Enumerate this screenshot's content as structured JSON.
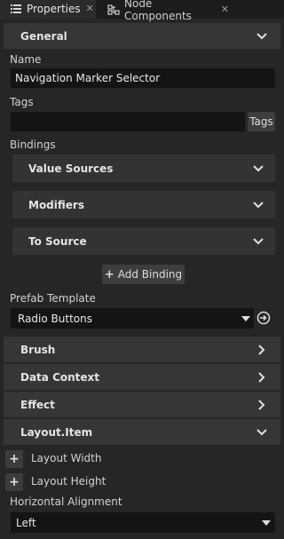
{
  "tabs": [
    {
      "label": "Properties",
      "icon": "list-icon",
      "active": true
    },
    {
      "label": "Node Components",
      "icon": "node-components-icon",
      "active": false
    }
  ],
  "sections": {
    "general": "General",
    "brush": "Brush",
    "data_context": "Data Context",
    "effect": "Effect",
    "layout_item": "Layout.Item"
  },
  "name": {
    "label": "Name",
    "value": "Navigation Marker Selector"
  },
  "tags": {
    "label": "Tags",
    "value": "",
    "button": "Tags"
  },
  "bindings": {
    "label": "Bindings",
    "groups": [
      "Value Sources",
      "Modifiers",
      "To Source"
    ],
    "add_button": "Add Binding"
  },
  "prefab_template": {
    "label": "Prefab Template",
    "value": "Radio Buttons"
  },
  "layout": {
    "width_label": "Layout Width",
    "height_label": "Layout Height",
    "horizontal_alignment_label": "Horizontal Alignment",
    "horizontal_alignment_value": "Left"
  },
  "colors": {
    "background": "#262626",
    "section": "#363636",
    "field": "#141414",
    "text": "#d6d6d6"
  }
}
